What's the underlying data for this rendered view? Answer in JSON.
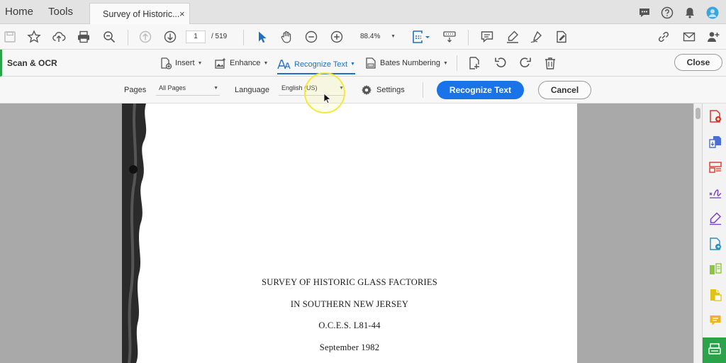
{
  "tabbar": {
    "home": "Home",
    "tools": "Tools",
    "doc_tab_title": "Survey of Historic...",
    "doc_tab_close": "×"
  },
  "toolbar": {
    "current_page": "1",
    "total_pages": "/ 519",
    "zoom": "88.4%"
  },
  "ocr_bar": {
    "title": "Scan & OCR",
    "insert": "Insert",
    "enhance": "Enhance",
    "recognize_text": "Recognize Text",
    "bates_numbering": "Bates Numbering",
    "close": "Close"
  },
  "options_bar": {
    "pages_label": "Pages",
    "pages_value": "All Pages",
    "language_label": "Language",
    "language_value": "English (US)",
    "settings": "Settings",
    "recognize_button": "Recognize Text",
    "cancel_button": "Cancel"
  },
  "document": {
    "lines": [
      "SURVEY OF HISTORIC GLASS FACTORIES",
      "IN SOUTHERN NEW JERSEY",
      "O.C.E.S. L81-44",
      "September 1982"
    ]
  },
  "colors": {
    "accent_blue": "#1a73e8",
    "ocr_green": "#2aa34a"
  }
}
